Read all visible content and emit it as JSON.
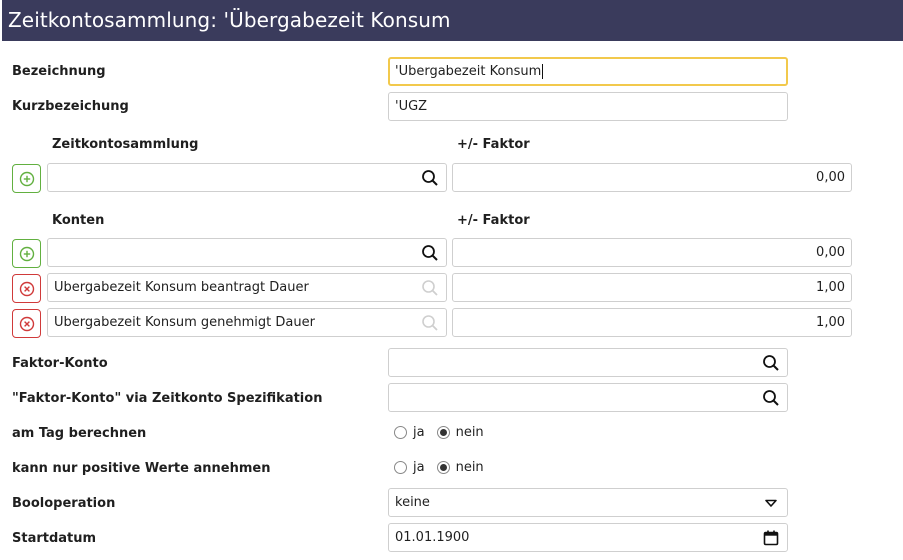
{
  "title": "Zeitkontosammlung: 'Übergabezeit Konsum",
  "fields": {
    "bezeichnung": {
      "label": "Bezeichnung",
      "value": "'Übergabezeit Konsum"
    },
    "kurzbezeichnung": {
      "label": "Kurzbezeichung",
      "value": "'ÜGZ"
    }
  },
  "zeitkontosammlung": {
    "header": "Zeitkontosammlung",
    "faktor_header": "+/- Faktor",
    "rows": [
      {
        "value": "",
        "faktor": "0,00"
      }
    ]
  },
  "konten": {
    "header": "Konten",
    "faktor_header": "+/- Faktor",
    "new_row": {
      "value": "",
      "faktor": "0,00"
    },
    "rows": [
      {
        "value": "Übergabezeit Konsum beantragt Dauer",
        "faktor": "1,00"
      },
      {
        "value": "Übergabezeit Konsum genehmigt Dauer",
        "faktor": "1,00"
      }
    ]
  },
  "faktor_konto": {
    "label": "Faktor-Konto",
    "value": ""
  },
  "faktor_konto_spez": {
    "label": "\"Faktor-Konto\" via Zeitkonto Spezifikation",
    "value": ""
  },
  "am_tag": {
    "label": "am Tag berechnen",
    "options": [
      "ja",
      "nein"
    ],
    "selected": "nein"
  },
  "positive": {
    "label": "kann nur positive Werte annehmen",
    "options": [
      "ja",
      "nein"
    ],
    "selected": "nein"
  },
  "booloperation": {
    "label": "Booloperation",
    "value": "keine"
  },
  "startdatum": {
    "label": "Startdatum",
    "value": "01.01.1900"
  },
  "icons": {
    "search": "search-icon",
    "search_disabled": "search-icon-disabled",
    "add": "plus-circle-icon",
    "remove": "x-circle-icon",
    "dropdown": "triangle-down-icon",
    "calendar": "calendar-icon"
  },
  "colors": {
    "titlebar": "#3a3b5c",
    "focus_border": "#f2c94c",
    "add_green": "#62b040",
    "remove_red": "#d03a3a"
  }
}
